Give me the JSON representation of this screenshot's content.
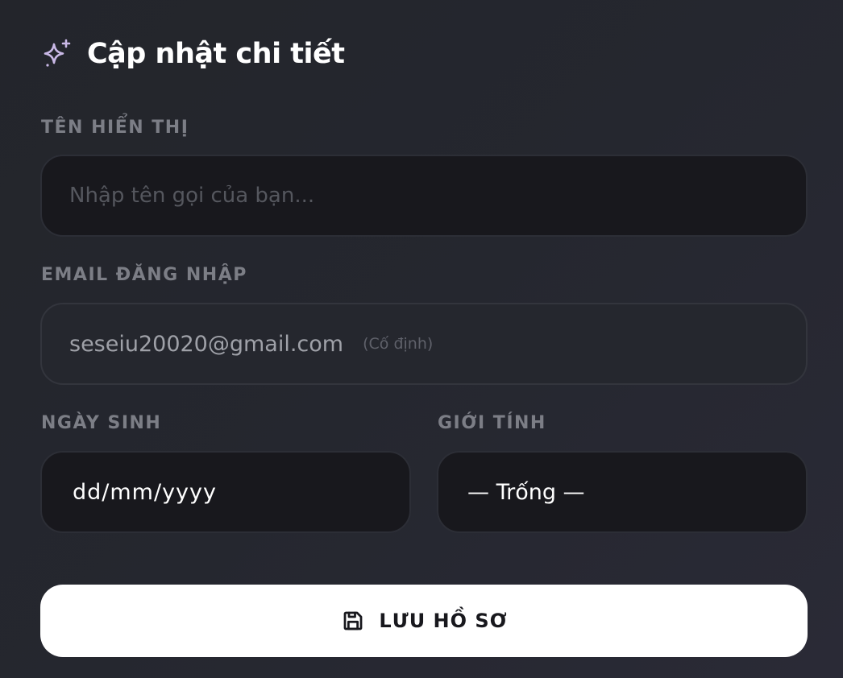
{
  "header": {
    "title": "Cập nhật chi tiết",
    "icon": "sparkles-icon",
    "icon_color": "#c9b8e6"
  },
  "form": {
    "display_name": {
      "label": "TÊN HIỂN THỊ",
      "value": "",
      "placeholder": "Nhập tên gọi của bạn..."
    },
    "email": {
      "label": "EMAIL ĐĂNG NHẬP",
      "value": "seseiu20020@gmail.com",
      "note": "(Cố định)"
    },
    "birthday": {
      "label": "NGÀY SINH",
      "value": "dd/mm/yyyy"
    },
    "gender": {
      "label": "GIỚI TÍNH",
      "selected": "— Trống —"
    }
  },
  "actions": {
    "save_label": "LƯU HỒ SƠ",
    "save_icon": "floppy-disk-icon"
  },
  "colors": {
    "background": "#23252b",
    "field_bg": "#18181d",
    "label": "#7c7e86",
    "button_bg": "#ffffff",
    "button_text": "#18181d"
  }
}
